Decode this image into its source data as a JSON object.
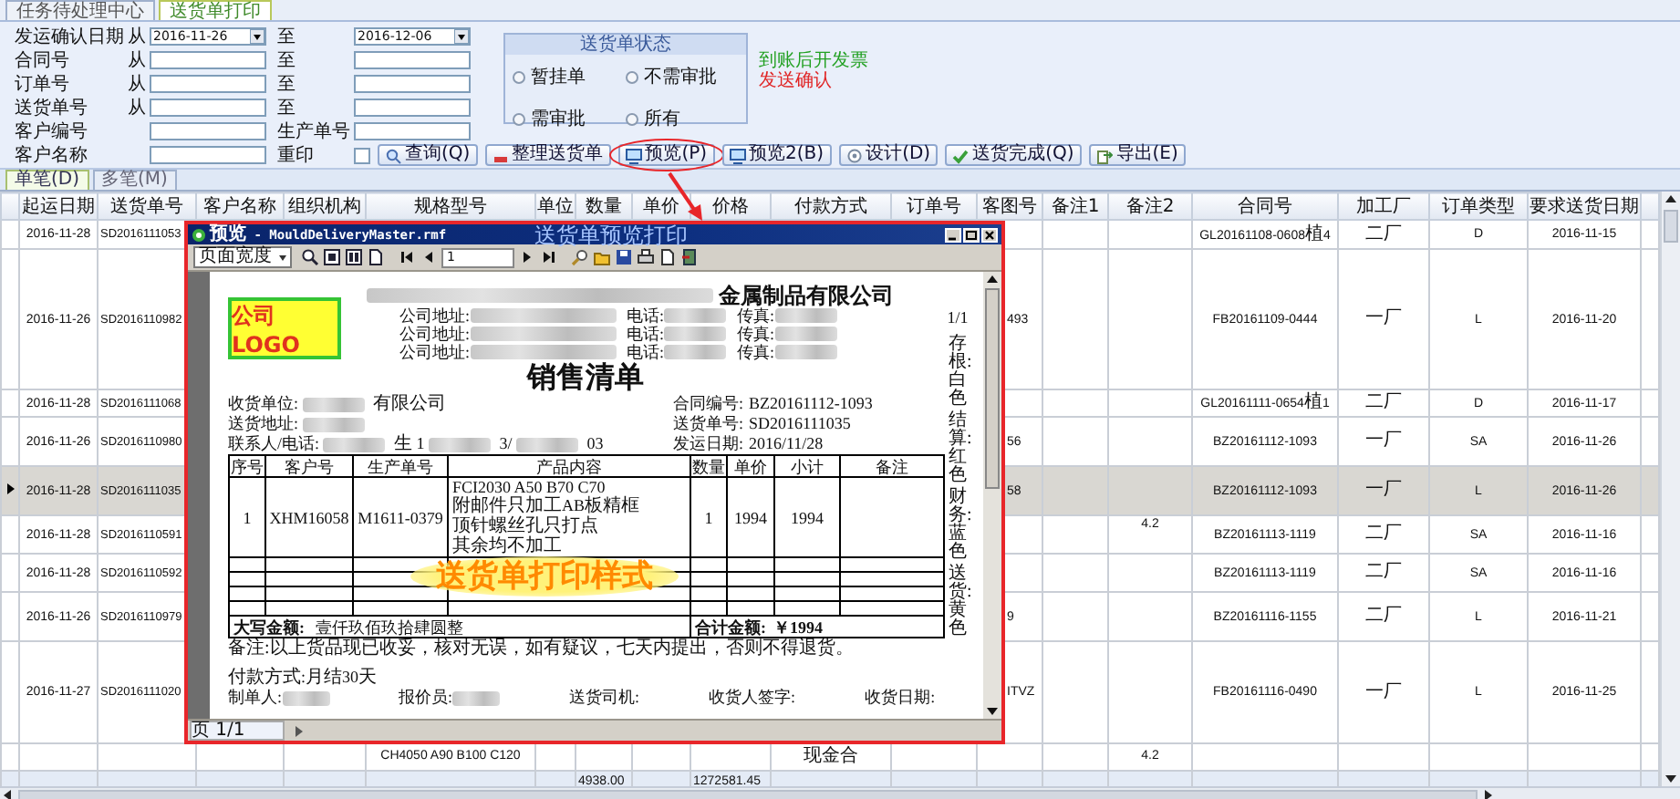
{
  "window_tabs": [
    {
      "label": "任务待处理中心",
      "selected": false
    },
    {
      "label": "送货单打印",
      "selected": true
    }
  ],
  "filter_rows": [
    {
      "label": "发运确认日期",
      "prefix": "从",
      "field1": {
        "kind": "date",
        "value": "2016-11-26"
      },
      "label2": "至",
      "field2": {
        "kind": "date",
        "value": "2016-12-06"
      }
    },
    {
      "label": "合同号",
      "prefix": "从",
      "field1": {
        "kind": "text"
      },
      "label2": "至",
      "field2": {
        "kind": "text"
      }
    },
    {
      "label": "订单号",
      "prefix": "从",
      "field1": {
        "kind": "text"
      },
      "label2": "至",
      "field2": {
        "kind": "text"
      }
    },
    {
      "label": "送货单号",
      "prefix": "从",
      "field1": {
        "kind": "text"
      },
      "label2": "至",
      "field2": {
        "kind": "text"
      }
    },
    {
      "label": "客户编号",
      "field1": {
        "kind": "text"
      },
      "label2": "生产单号",
      "field2": {
        "kind": "text"
      }
    },
    {
      "label": "客户名称",
      "field1": {
        "kind": "text"
      },
      "label2": "重印",
      "field2": {
        "kind": "checkbox",
        "checked": false
      }
    }
  ],
  "status_group": {
    "title": "送货单状态",
    "options": [
      {
        "label": "暂挂单",
        "selected": false
      },
      {
        "label": "不需审批",
        "selected": false
      },
      {
        "label": "需审批",
        "selected": false
      },
      {
        "label": "所有",
        "selected": false
      }
    ]
  },
  "notes": [
    {
      "text": "到账后开发票",
      "color": "#22a022"
    },
    {
      "text": "发送确认",
      "color": "#e02424"
    }
  ],
  "buttons": [
    {
      "label": "查询(Q)",
      "circled": false
    },
    {
      "label": "整理送货单",
      "circled": false
    },
    {
      "label": "预览(P)",
      "circled": true
    },
    {
      "label": "预览2(B)",
      "circled": false
    },
    {
      "label": "设计(D)",
      "circled": false
    },
    {
      "label": "送货完成(Q)",
      "circled": false
    },
    {
      "label": "导出(E)",
      "circled": false
    }
  ],
  "sub_tabs": [
    {
      "label": "单笔(D)",
      "selected": true
    },
    {
      "label": "多笔(M)",
      "selected": false
    }
  ],
  "table": {
    "columns": [
      "起运日期",
      "送货单号",
      "客户名称",
      "组织机构",
      "规格型号",
      "单位",
      "数量",
      "单价",
      "价格",
      "付款方式",
      "订单号",
      "客图号",
      "备注1",
      "备注2",
      "合同号",
      "加工厂",
      "订单类型",
      "要求送货日期"
    ],
    "rows": [
      {
        "selected": false,
        "start_date": "2016-11-28",
        "delivery_no": "SD2016111053",
        "contract_no": "GL20161108-0608植4",
        "factory": "二厂",
        "order_type": "D",
        "due_date": "2016-11-15"
      },
      {
        "selected": false,
        "start_date": "2016-11-26",
        "delivery_no": "SD2016110982",
        "drawing_no": "493",
        "contract_no": "FB20161109-0444",
        "factory": "一厂",
        "order_type": "L",
        "due_date": "2016-11-20"
      },
      {
        "selected": false,
        "start_date": "2016-11-28",
        "delivery_no": "SD2016111068",
        "contract_no": "GL20161111-0654植1",
        "factory": "二厂",
        "order_type": "D",
        "due_date": "2016-11-17"
      },
      {
        "selected": false,
        "start_date": "2016-11-26",
        "delivery_no": "SD2016110980",
        "drawing_no": "56",
        "contract_no": "BZ20161112-1093",
        "factory": "一厂",
        "order_type": "SA",
        "due_date": "2016-11-26"
      },
      {
        "selected": true,
        "start_date": "2016-11-28",
        "delivery_no": "SD2016111035",
        "drawing_no": "58",
        "contract_no": "BZ20161112-1093",
        "factory": "一厂",
        "order_type": "L",
        "due_date": "2016-11-26"
      },
      {
        "selected": false,
        "start_date": "2016-11-28",
        "delivery_no": "SD2016110591",
        "remark2": "4.2",
        "contract_no": "BZ20161113-1119",
        "factory": "二厂",
        "order_type": "SA",
        "due_date": "2016-11-16"
      },
      {
        "selected": false,
        "start_date": "2016-11-28",
        "delivery_no": "SD2016110592",
        "contract_no": "BZ20161113-1119",
        "factory": "二厂",
        "order_type": "SA",
        "due_date": "2016-11-16"
      },
      {
        "selected": false,
        "start_date": "2016-11-26",
        "delivery_no": "SD2016110979",
        "drawing_no": "9",
        "contract_no": "BZ20161116-1155",
        "factory": "二厂",
        "order_type": "L",
        "due_date": "2016-11-21"
      },
      {
        "selected": false,
        "start_date": "2016-11-27",
        "delivery_no": "SD2016111020",
        "drawing_no": "ITVZ",
        "contract_no": "FB20161116-0490",
        "factory": "一厂",
        "order_type": "L",
        "due_date": "2016-11-25"
      },
      {
        "selected": false,
        "spec": "CH4050 A90 B100 C120",
        "payment": "现金合",
        "remark2": "4.2"
      }
    ],
    "totals": {
      "qty": "4938.00",
      "price": "1272581.45"
    }
  },
  "preview": {
    "title": "预览 - MouldDeliveryMaster.rmf",
    "caption": "送货单预览打印",
    "zoom_select": "页面宽度",
    "page_input": "1",
    "status": "页 1/1",
    "document": {
      "logo": "公司LOGO",
      "company_suffix": "金属制品有限公司",
      "page_no": "1/1",
      "address_lines": [
        {
          "address": "公司地址:",
          "phone": "电话:",
          "fax": "传真:"
        },
        {
          "address": "公司地址:",
          "phone": "电话:",
          "fax": "传真:"
        },
        {
          "address": "公司地址:",
          "phone": "电话:",
          "fax": "传真:"
        }
      ],
      "title": "销售清单",
      "left_info": [
        {
          "label": "收货单位:",
          "parts": [
            {
              "kind": "blur"
            },
            {
              "kind": "text",
              "text": "有限公司"
            }
          ]
        },
        {
          "label": "送货地址:",
          "parts": [
            {
              "kind": "blur"
            }
          ]
        },
        {
          "label": "联系人/电话:",
          "parts": [
            {
              "kind": "blur"
            },
            {
              "kind": "text",
              "text": "生 1"
            },
            {
              "kind": "blur"
            },
            {
              "kind": "text",
              "text": "3/"
            },
            {
              "kind": "blur"
            },
            {
              "kind": "text",
              "text": "03"
            }
          ]
        }
      ],
      "right_info": [
        {
          "label": "合同编号:",
          "value": "BZ20161112-1093"
        },
        {
          "label": "送货单号:",
          "value": "SD2016111035"
        },
        {
          "label": "发运日期:",
          "value": "2016/11/28"
        }
      ],
      "columns": [
        "序号",
        "客户号",
        "生产单号",
        "产品内容",
        "数量",
        "单价",
        "小计",
        "备注"
      ],
      "rows": [
        {
          "no": "1",
          "customer": "XHM16058",
          "job_no": "M1611-0379",
          "content": [
            "FCI2030 A50 B70 C70",
            "附邮件只加工AB板精框",
            "顶针螺丝孔只打点",
            "其余均不加工"
          ],
          "qty": "1",
          "unit_price": "1994",
          "subtotal": "1994"
        }
      ],
      "stamp": "送货单打印样式",
      "amount_words_label": "大写金额:",
      "amount_words": "壹仟玖佰玖拾肆圆整",
      "total_label": "合计金额:",
      "total": "￥1994",
      "note": "备注:以上货品现已收妥，核对无误，如有疑议，七天内提出，否则不得退货。",
      "payment": "付款方式:月结30天",
      "signatures": [
        {
          "label": "制单人:",
          "blurred": true
        },
        {
          "label": "报价员:",
          "blurred": true
        },
        {
          "label": "送货司机:"
        },
        {
          "label": "收货人签字:"
        },
        {
          "label": "收货日期:"
        }
      ],
      "copies": [
        "存根:白色",
        "结算:红色",
        "财务:蓝色",
        "送货:黄色"
      ]
    }
  }
}
